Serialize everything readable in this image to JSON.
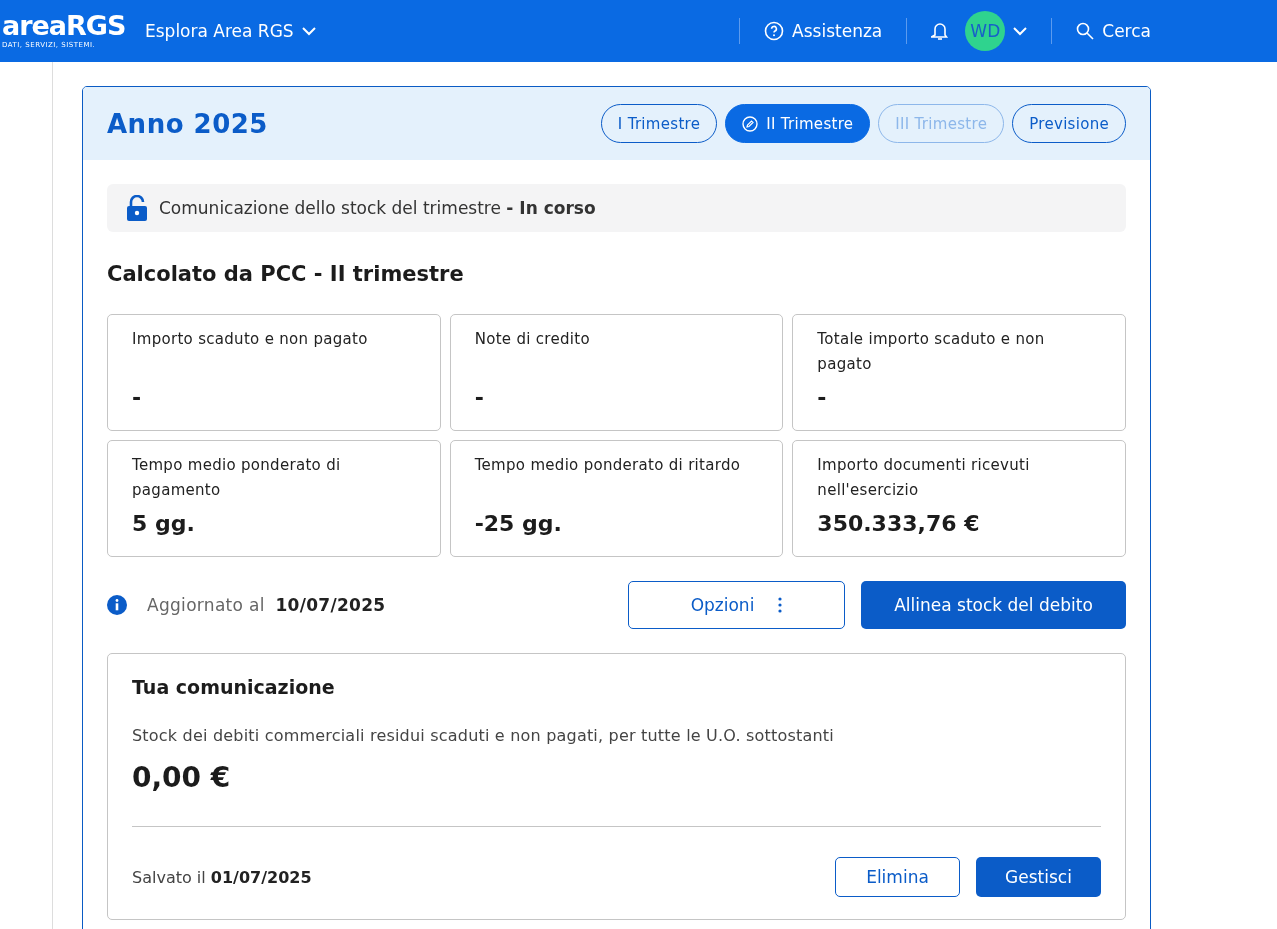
{
  "header": {
    "logo": "areaRGS",
    "tagline": "DATI, SERVIZI, SISTEMI.",
    "explore": "Esplora Area RGS",
    "help": "Assistenza",
    "avatar": "WD",
    "search": "Cerca"
  },
  "year": {
    "title": "Anno 2025",
    "tabs": [
      {
        "label": "I Trimestre",
        "selected": false,
        "disabled": false
      },
      {
        "label": "II Trimestre",
        "selected": true,
        "disabled": false
      },
      {
        "label": "III Trimestre",
        "selected": false,
        "disabled": true
      },
      {
        "label": "Previsione",
        "selected": false,
        "disabled": false
      }
    ]
  },
  "status": "Comunicazione dello stock del trimestre **- In corso**",
  "section_title": "Calcolato da PCC - II trimestre",
  "stats": [
    {
      "label": "Importo scaduto e non pagato",
      "value": "-"
    },
    {
      "label": "Note di credito",
      "value": "-"
    },
    {
      "label": "Totale importo scaduto e non pagato",
      "value": "-"
    },
    {
      "label": "Tempo medio ponderato di pagamento",
      "value": "5 gg."
    },
    {
      "label": "Tempo medio ponderato di ritardo",
      "value": "-25 gg."
    },
    {
      "label": "Importo documenti ricevuti nell'esercizio",
      "value": "350.333,76 €"
    }
  ],
  "updated": "Aggiornato al **10/07/2025**",
  "options_button": "Opzioni",
  "align_button": "Allinea stock del debito",
  "communication": {
    "title": "Tua comunicazione",
    "description": "Stock dei debiti commerciali residui scaduti e non pagati, per tutte le U.O. sottostanti",
    "amount": "0,00 €",
    "saved": "Salvato il **01/07/2025**",
    "delete_button": "Elimina",
    "manage_button": "Gestisci"
  }
}
